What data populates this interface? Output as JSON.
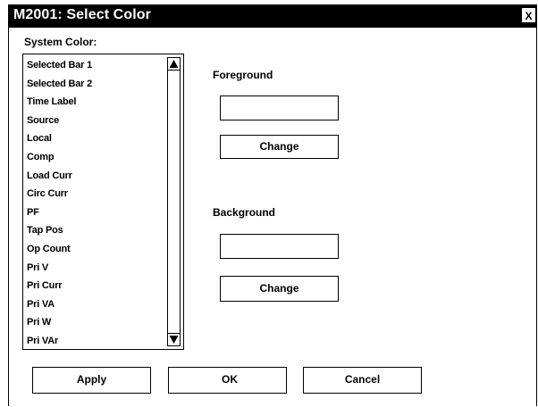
{
  "window": {
    "title": "M2001: Select Color",
    "close_label": "X"
  },
  "system_color": {
    "label": "System Color:",
    "items": [
      "Selected Bar 1",
      "Selected Bar 2",
      "Time Label",
      "Source",
      "Local",
      "Comp",
      "Load Curr",
      "Circ Curr",
      "PF",
      "Tap Pos",
      "Op Count",
      "Pri V",
      "Pri Curr",
      "Pri VA",
      "Pri W",
      "Pri VAr"
    ]
  },
  "foreground": {
    "label": "Foreground",
    "change_label": "Change",
    "swatch_color": "#ffffff"
  },
  "background": {
    "label": "Background",
    "change_label": "Change",
    "swatch_color": "#ffffff"
  },
  "buttons": {
    "apply": "Apply",
    "ok": "OK",
    "cancel": "Cancel"
  }
}
